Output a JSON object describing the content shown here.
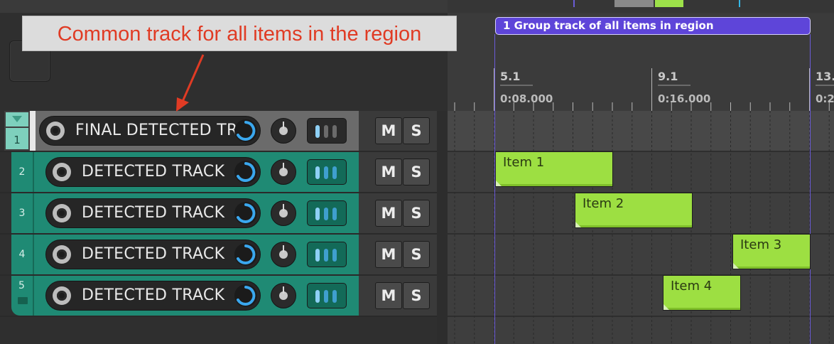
{
  "annotation": {
    "text": "Common track for all items in the region"
  },
  "region": {
    "label": "1  Group track of all items in region",
    "color": "#5e45d9"
  },
  "ruler": {
    "markers": [
      {
        "bar": "5.1",
        "time": "0:08.000"
      },
      {
        "bar": "9.1",
        "time": "0:16.000"
      },
      {
        "bar": "13.",
        "time": "0:2"
      }
    ]
  },
  "tracks": [
    {
      "number": "1",
      "name": "FINAL DETECTED TR",
      "mute": "M",
      "solo": "S",
      "color": "#6b6b6b",
      "folder": true
    },
    {
      "number": "2",
      "name": "DETECTED TRACK",
      "mute": "M",
      "solo": "S",
      "color": "#1f8a74"
    },
    {
      "number": "3",
      "name": "DETECTED TRACK",
      "mute": "M",
      "solo": "S",
      "color": "#1f8a74"
    },
    {
      "number": "4",
      "name": "DETECTED TRACK",
      "mute": "M",
      "solo": "S",
      "color": "#1f8a74"
    },
    {
      "number": "5",
      "name": "DETECTED TRACK",
      "mute": "M",
      "solo": "S",
      "color": "#1f8a74"
    }
  ],
  "items": [
    {
      "label": "Item 1",
      "track": 2,
      "color": "#9ddf42"
    },
    {
      "label": "Item 2",
      "track": 3,
      "color": "#9ddf42"
    },
    {
      "label": "Item 3",
      "track": 4,
      "color": "#9ddf42"
    },
    {
      "label": "Item 4",
      "track": 5,
      "color": "#9ddf42"
    }
  ]
}
